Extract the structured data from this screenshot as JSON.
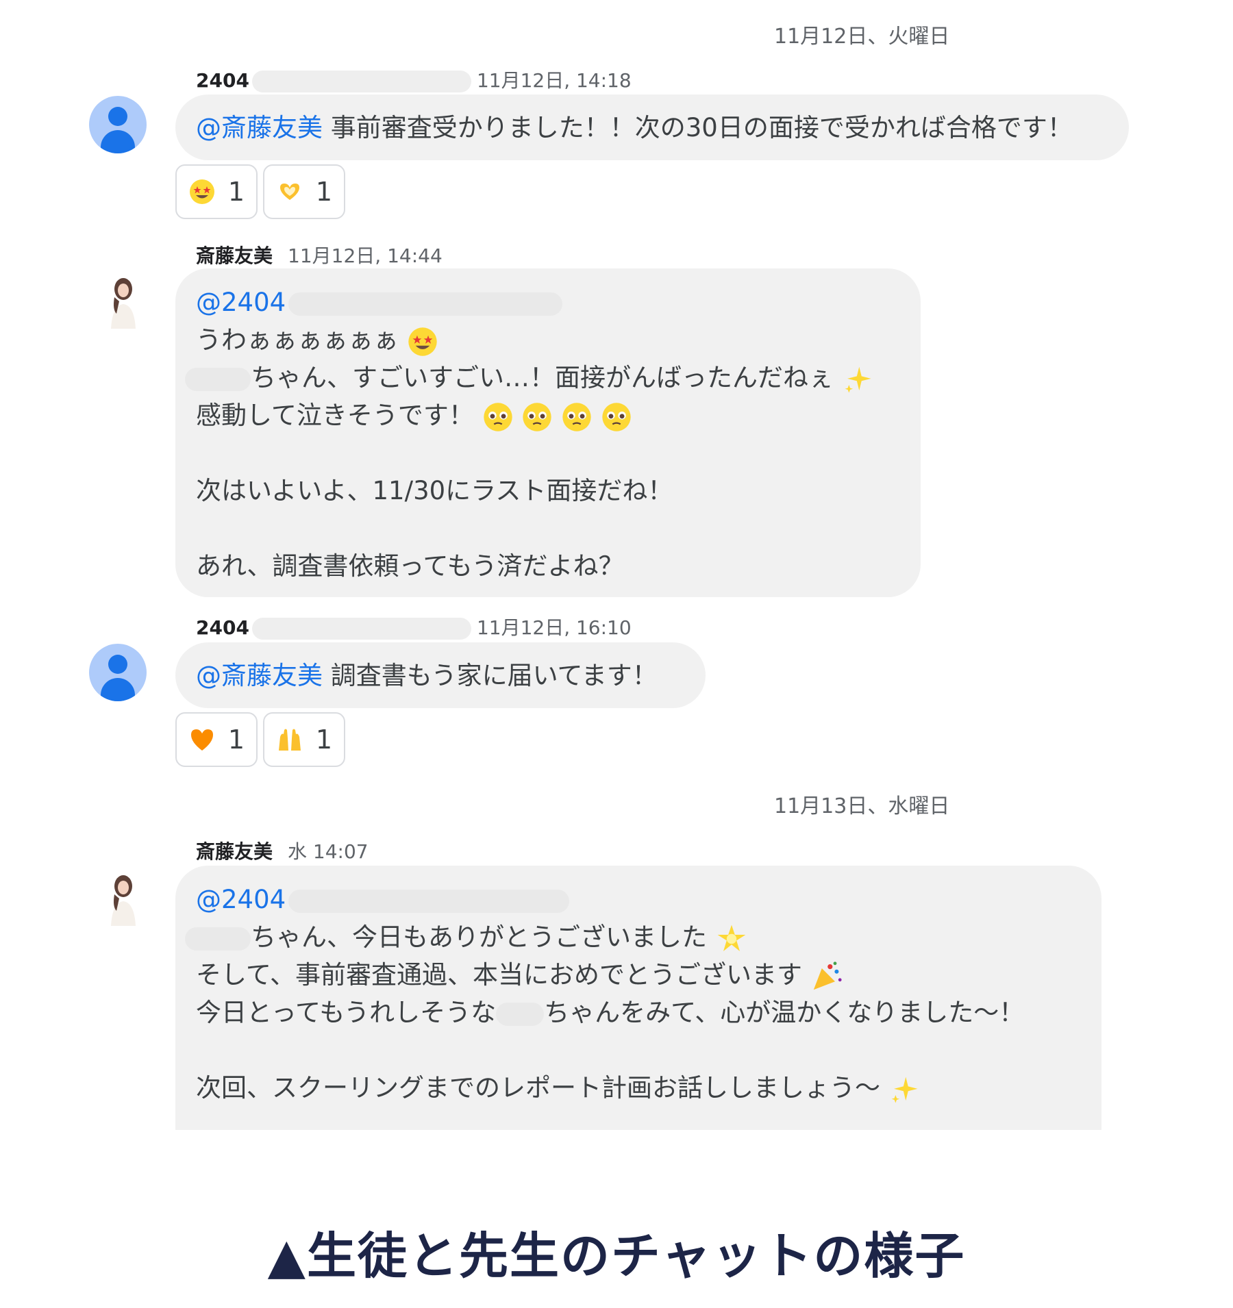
{
  "dates": {
    "day1": "11月12日、火曜日",
    "day2": "11月13日、水曜日"
  },
  "messages": {
    "m1": {
      "sender": "2404",
      "time": "11月12日, 14:18",
      "mention": "@斎藤友美",
      "text": " 事前審査受かりました！！次の30日の面接で受かれば合格です！",
      "reactions": [
        {
          "emoji": "star-struck-icon",
          "count": "1"
        },
        {
          "emoji": "heart-hands-icon",
          "count": "1"
        }
      ]
    },
    "m2": {
      "sender": "斎藤友美",
      "time": "11月12日, 14:44",
      "mention": "@2404",
      "line1": "うわぁぁぁぁぁぁ",
      "line2": "ちゃん、すごいすごい…！面接がんばったんだねぇ",
      "line3": "感動して泣きそうです！",
      "line4": "次はいよいよ、11/30にラスト面接だね！",
      "line5": "あれ、調査書依頼ってもう済だよね？"
    },
    "m3": {
      "sender": "2404",
      "time": "11月12日, 16:10",
      "mention": "@斎藤友美",
      "text": " 調査書もう家に届いてます！",
      "reactions": [
        {
          "emoji": "orange-heart-icon",
          "count": "1"
        },
        {
          "emoji": "raising-hands-icon",
          "count": "1"
        }
      ]
    },
    "m4": {
      "sender": "斎藤友美",
      "time": "水 14:07",
      "mention": "@2404",
      "line1": "ちゃん、今日もありがとうございました",
      "line2": "そして、事前審査通過、本当におめでとうございます",
      "line3a": "今日とってもうれしそうな",
      "line3b": "ちゃんをみて、心が温かくなりました～！",
      "line4": "次回、スクーリングまでのレポート計画お話ししましょう～"
    }
  },
  "caption": "▲生徒と先生のチャットの様子",
  "colors": {
    "mention": "#1a73e8",
    "bubble": "#f1f1f1",
    "caption": "#1d2547"
  }
}
